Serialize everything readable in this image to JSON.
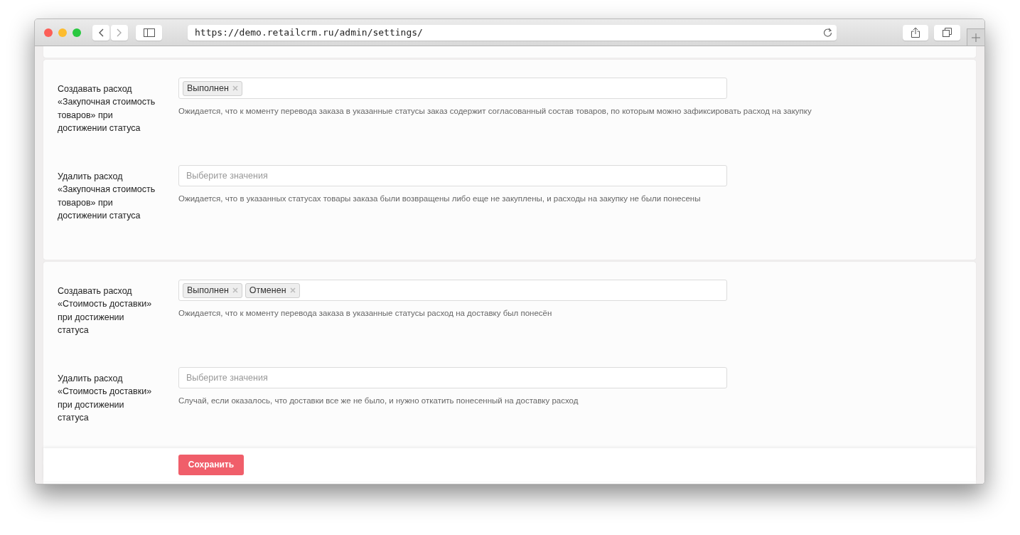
{
  "browser": {
    "url": "https://demo.retailcrm.ru/admin/settings/"
  },
  "sections": [
    {
      "fields": [
        {
          "label": "Создавать расход «Закупочная стоимость товаров» при достижении статуса",
          "tags": [
            "Выполнен"
          ],
          "hint": "Ожидается, что к моменту перевода заказа в указанные статусы заказ содержит согласованный состав товаров, по которым можно зафиксировать расход на закупку"
        },
        {
          "label": "Удалить расход «Закупочная стоимость товаров» при достижении статуса",
          "placeholder": "Выберите значения",
          "hint": "Ожидается, что в указанных статусах товары заказа были возвращены либо еще не закуплены, и расходы на закупку не были понесены"
        }
      ]
    },
    {
      "fields": [
        {
          "label": "Создавать расход «Стоимость доставки» при достижении статуса",
          "tags": [
            "Выполнен",
            "Отменен"
          ],
          "hint": "Ожидается, что к моменту перевода заказа в указанные статусы расход на доставку был понесён"
        },
        {
          "label": "Удалить расход «Стоимость доставки» при достижении статуса",
          "placeholder": "Выберите значения",
          "hint": "Случай, если оказалось, что доставки все же не было, и нужно откатить понесенный на доставку расход"
        }
      ]
    }
  ],
  "footer": {
    "save_button": "Сохранить"
  }
}
